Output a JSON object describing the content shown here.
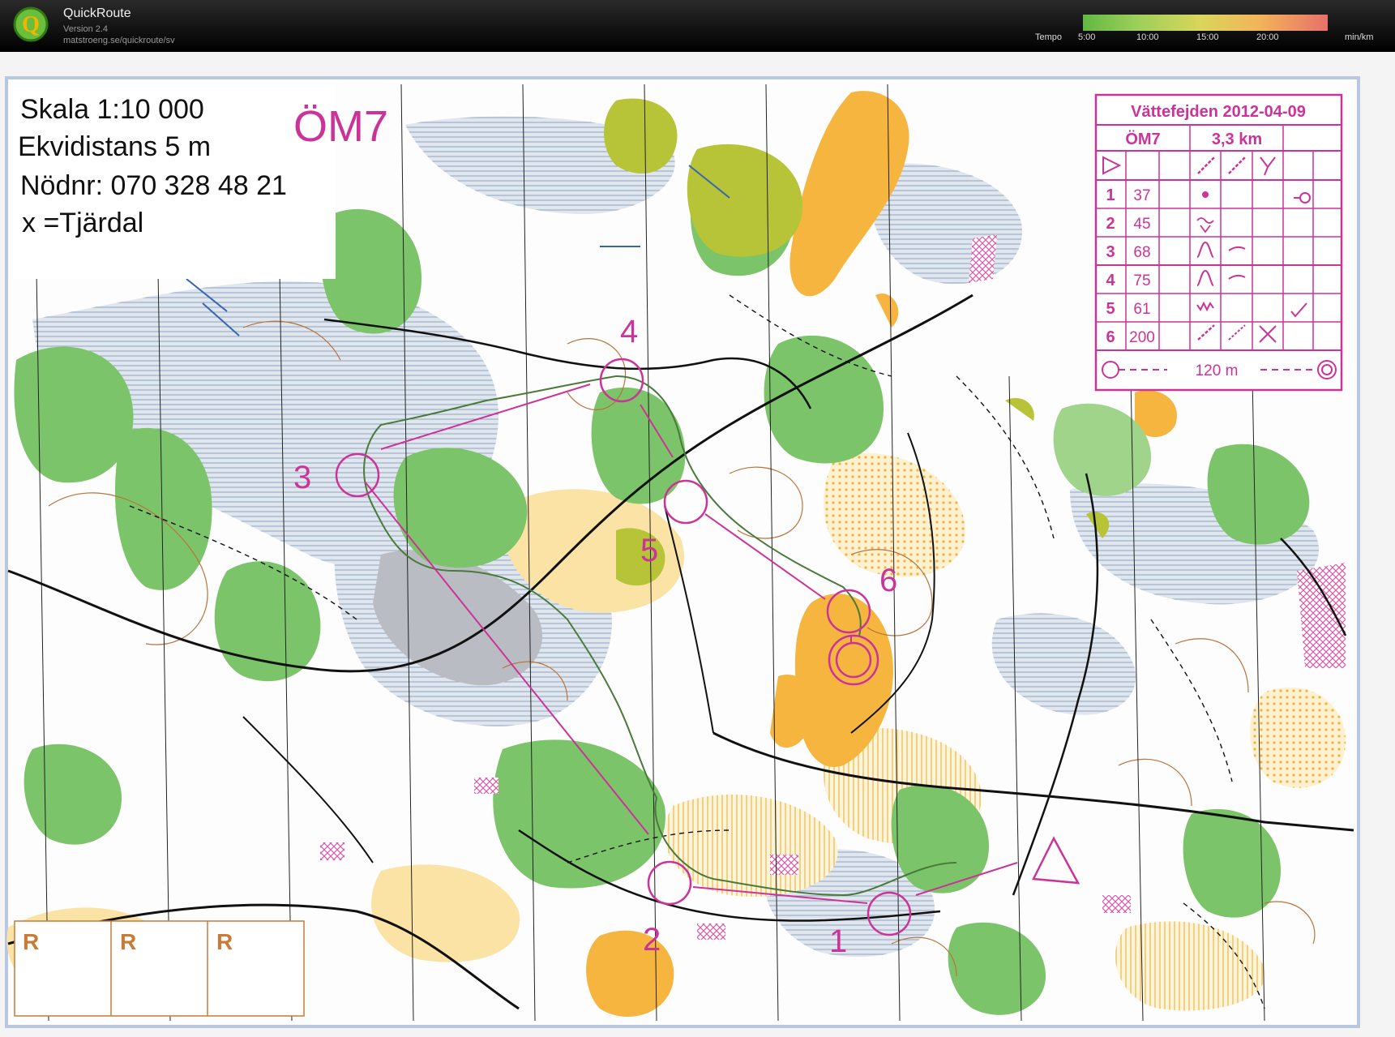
{
  "app": {
    "name": "QuickRoute",
    "version": "Version 2.4",
    "url": "matstroeng.se/quickroute/sv",
    "logo_letter": "Q"
  },
  "tempo": {
    "label": "Tempo",
    "ticks": [
      "5:00",
      "10:00",
      "15:00",
      "20:00"
    ],
    "unit": "min/km"
  },
  "map": {
    "scale": "Skala 1:10 000",
    "contour": "Ekvidistans 5 m",
    "emergency": "Nödnr: 070 328 48 21",
    "legend_x": "x =Tjärdal",
    "course_title": "ÖM7",
    "control_labels": [
      "1",
      "2",
      "3",
      "4",
      "5",
      "6"
    ],
    "r_boxes": [
      "R",
      "R",
      "R"
    ]
  },
  "control_card": {
    "event": "Vättefejden 2012-04-09",
    "course": "ÖM7",
    "length": "3,3 km",
    "rows": [
      {
        "num": "1",
        "code": "37"
      },
      {
        "num": "2",
        "code": "45"
      },
      {
        "num": "3",
        "code": "68"
      },
      {
        "num": "4",
        "code": "75"
      },
      {
        "num": "5",
        "code": "61"
      },
      {
        "num": "6",
        "code": "200"
      }
    ],
    "finish_distance": "120 m"
  },
  "colors": {
    "course": "#cc3399",
    "route": "#4a7a3a",
    "forest_green": "#7cc46a",
    "open_yellow": "#f5b53f",
    "light_yellow": "#fbe3a6",
    "marsh_blue": "#b8c8dc",
    "contour": "#b8733a",
    "road": "#111111",
    "box_orange": "#c77b36"
  }
}
